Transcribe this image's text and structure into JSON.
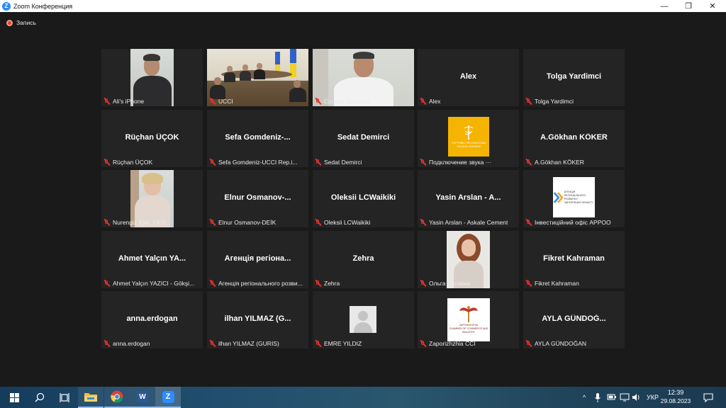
{
  "window": {
    "title": "Zoom Конференция",
    "logo_letter": "Z",
    "minimize": "—",
    "restore": "❐",
    "close": "✕"
  },
  "recording": {
    "label": "Запись"
  },
  "tiles": [
    {
      "id": "t1",
      "big": "",
      "caption": "Ali's iPhone",
      "kind": "video"
    },
    {
      "id": "t2",
      "big": "",
      "caption": "UCCI",
      "kind": "video"
    },
    {
      "id": "t3",
      "big": "",
      "caption": "Cuneyt Tascioglu",
      "kind": "video"
    },
    {
      "id": "t4",
      "big": "Alex",
      "caption": "Alex",
      "kind": "name"
    },
    {
      "id": "t5",
      "big": "Tolga Yardimci",
      "caption": "Tolga Yardimci",
      "kind": "name"
    },
    {
      "id": "t6",
      "big": "Rüçhan ÜÇOK",
      "caption": "Rüçhan ÜÇOK",
      "kind": "name"
    },
    {
      "id": "t7",
      "big": "Sefa  Gomdeniz-...",
      "caption": "Sefa Gomdeniz-UCCI Rep.i...",
      "kind": "name"
    },
    {
      "id": "t8",
      "big": "Sedat Demirci",
      "caption": "Sedat Demirci",
      "kind": "name"
    },
    {
      "id": "t9",
      "big": "",
      "caption": "Подключение звука ···",
      "kind": "logo",
      "logo_lines": [
        "ТОРГОВО-ПРОМИСЛОВА",
        "ПАЛАТА УКРАЇНИ"
      ]
    },
    {
      "id": "t10",
      "big": "A.Gökhan KÖKER",
      "caption": "A.Gökhan KÖKER",
      "kind": "name"
    },
    {
      "id": "t11",
      "big": "",
      "caption": "Nurengiz Eşki, DEİK",
      "kind": "video"
    },
    {
      "id": "t12",
      "big": "Elnur  Osmanov-...",
      "caption": "Elnur Osmanov-DEİK",
      "kind": "name"
    },
    {
      "id": "t13",
      "big": "Oleksii LCWaikiki",
      "caption": "Oleksii LCWaikiki",
      "kind": "name"
    },
    {
      "id": "t14",
      "big": "Yasin Arslan - A...",
      "caption": "Yasin Arslan - Askale Cement",
      "kind": "name"
    },
    {
      "id": "t15",
      "big": "",
      "caption": "Інвестиційний офіс APPOO",
      "kind": "logo2",
      "logo_lines": [
        "АГЕНЦІЯ",
        "РЕГІОНАЛЬНОГО РОЗВИТКУ",
        "ЗАПОРІЗЬКОЇ ОБЛАСТІ"
      ]
    },
    {
      "id": "t16",
      "big": "Ahmet Yalçın YA...",
      "caption": "Ahmet Yalçın YAZICI - Gökşi...",
      "kind": "name"
    },
    {
      "id": "t17",
      "big": "Агенція регіона...",
      "caption": "Агенція регіонального розви...",
      "kind": "name"
    },
    {
      "id": "t18",
      "big": "Zehra",
      "caption": "Zehra",
      "kind": "name"
    },
    {
      "id": "t19",
      "big": "",
      "caption": "Ольга Щолкіна",
      "kind": "video"
    },
    {
      "id": "t20",
      "big": "Fikret Kahraman",
      "caption": "Fikret Kahraman",
      "kind": "name"
    },
    {
      "id": "t21",
      "big": "anna.erdogan",
      "caption": "anna.erdogan",
      "kind": "name"
    },
    {
      "id": "t22",
      "big": "ilhan YILMAZ (G...",
      "caption": "ilhan YILMAZ (GURIS)",
      "kind": "name"
    },
    {
      "id": "t23",
      "big": "",
      "caption": "EMRE YILDIZ",
      "kind": "avatar"
    },
    {
      "id": "t24",
      "big": "",
      "caption": "Zaporizhzhia CCI",
      "kind": "logo3",
      "logo_lines": [
        "ZAPORIZHZHIA",
        "CHAMBER OF COMMERCE AND INDUSTRY"
      ]
    },
    {
      "id": "t25",
      "big": "AYLA GÜNDOĞ...",
      "caption": "AYLA GÜNDOĞAN",
      "kind": "name"
    }
  ],
  "taskbar": {
    "apps": [
      "windows-start",
      "search",
      "task-view",
      "file-explorer",
      "chrome",
      "word",
      "zoom"
    ],
    "word_letter": "W",
    "zoom_letter": "Z",
    "language": "УКР",
    "time": "12:39",
    "date": "29.08.2023",
    "tray_chevron": "^"
  },
  "colors": {
    "accent_zoom": "#2d8cff",
    "mute_red": "#e03131",
    "tile_bg": "#242424",
    "stage_bg": "#1a1a1a"
  }
}
